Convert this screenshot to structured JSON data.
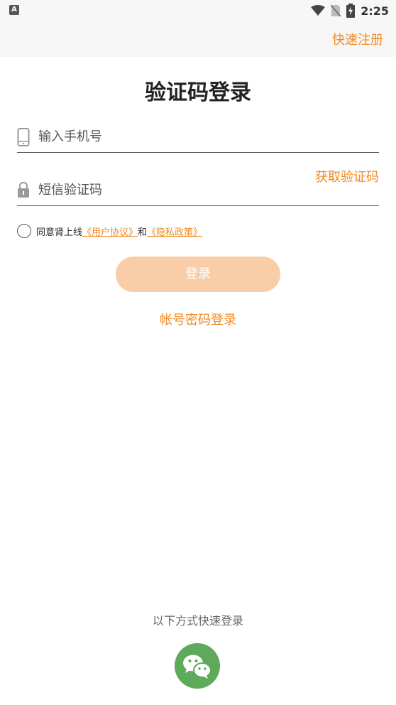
{
  "status_bar": {
    "app_icon_letter": "A",
    "time": "2:25"
  },
  "header": {
    "quick_register": "快速注册"
  },
  "title": "验证码登录",
  "phone_field": {
    "placeholder": "输入手机号",
    "value": ""
  },
  "code_field": {
    "placeholder": "短信验证码",
    "value": "",
    "get_code_label": "获取验证码"
  },
  "agreement": {
    "prefix": "同意肾上线",
    "user_agreement": "《用户协议》",
    "and": "和",
    "privacy_policy": "《隐私政策》"
  },
  "login_button": "登录",
  "password_login": "帐号密码登录",
  "quick_login_hint": "以下方式快速登录",
  "colors": {
    "accent": "#f08a24",
    "button_bg": "#f8cda7",
    "wechat_green": "#5fa95a"
  },
  "icons": {
    "phone": "phone-icon",
    "lock": "lock-icon",
    "wechat": "wechat-icon"
  }
}
